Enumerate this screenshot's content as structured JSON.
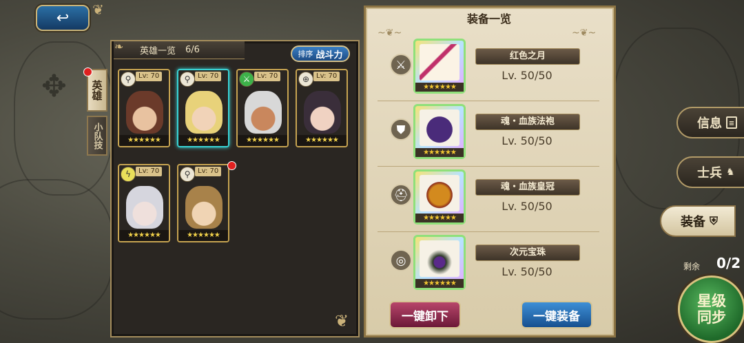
{
  "nav": {
    "back_icon": "↩"
  },
  "heroes": {
    "title": "英雄一览",
    "count": "6/6",
    "sort_prefix": "排序",
    "sort_value": "战斗力",
    "tabs": [
      {
        "label": "英雄"
      },
      {
        "label": "小队技"
      }
    ],
    "cards": [
      {
        "level": "Lv: 70",
        "class_icon": "magnifier",
        "stars": "★★★★★★",
        "hair": "#6b3a2a",
        "skin": "#e8c2a0"
      },
      {
        "level": "Lv: 70",
        "class_icon": "magnifier",
        "stars": "★★★★★★",
        "hair": "#e8d27a",
        "skin": "#f1d3b8"
      },
      {
        "level": "Lv: 70",
        "class_icon": "sword",
        "stars": "★★★★★★",
        "hair": "#d8d8d8",
        "skin": "#c9875d"
      },
      {
        "level": "Lv: 70",
        "class_icon": "crosshair",
        "stars": "★★★★★★",
        "hair": "#3a2e3a",
        "skin": "#f0d2c2"
      },
      {
        "level": "Lv: 70",
        "class_icon": "lightning",
        "stars": "★★★★★★",
        "hair": "#d6d6de",
        "skin": "#efe0dc"
      },
      {
        "level": "Lv: 70",
        "class_icon": "magnifier",
        "stars": "★★★★★★",
        "hair": "#a8824a",
        "skin": "#f0d4b4"
      }
    ]
  },
  "equipment": {
    "title": "装备一览",
    "items": [
      {
        "name": "红色之月",
        "level": "Lv. 50/50",
        "slot_icon": "sword",
        "stars": "★★★★★★"
      },
      {
        "name": "魂・血族法袍",
        "level": "Lv. 50/50",
        "slot_icon": "armor",
        "stars": "★★★★★★"
      },
      {
        "name": "魂・血族皇冠",
        "level": "Lv. 50/50",
        "slot_icon": "helmet",
        "stars": "★★★★★★"
      },
      {
        "name": "次元宝珠",
        "level": "Lv. 50/50",
        "slot_icon": "ring",
        "stars": "★★★★★★"
      }
    ],
    "unequip_all": "一键卸下",
    "equip_all": "一键装备"
  },
  "side_menu": {
    "info": "信息",
    "soldier": "士兵",
    "equip": "装备",
    "remain_label": "剩余",
    "remain_value": "0/2",
    "star_sync_line1": "星级",
    "star_sync_line2": "同步"
  },
  "colors": {
    "accent_gold": "#c7a451",
    "selected": "#39d4d6",
    "equip_blue": "#3d8fd6",
    "unequip_red": "#b7466a"
  }
}
